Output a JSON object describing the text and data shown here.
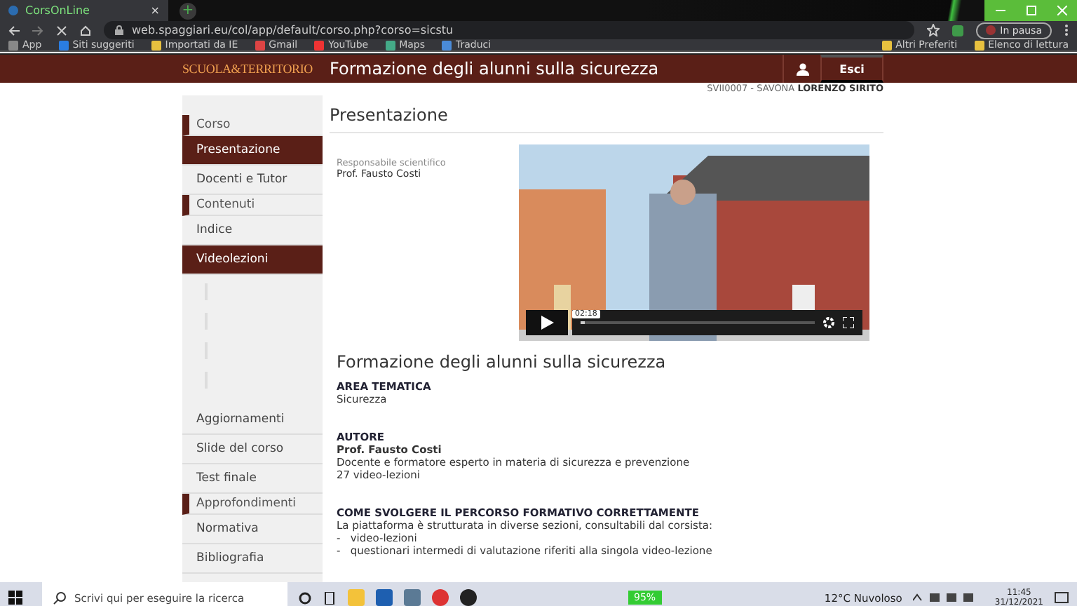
{
  "browser": {
    "tab": {
      "title": "CorsOnLine",
      "close": "×",
      "new_tab": "+"
    },
    "url": "web.spaggiari.eu/col/app/default/corso.php?corso=sicstu",
    "profile": "In pausa",
    "bookmarks": [
      {
        "label": "App"
      },
      {
        "label": "Siti suggeriti"
      },
      {
        "label": "Importati da IE"
      },
      {
        "label": "Gmail"
      },
      {
        "label": "YouTube"
      },
      {
        "label": "Maps"
      },
      {
        "label": "Traduci"
      }
    ],
    "bookmarks_right": [
      {
        "label": "Altri Preferiti"
      },
      {
        "label": "Elenco di lettura"
      }
    ]
  },
  "header": {
    "logo": "SCUOLA&TERRITORIO",
    "title": "Formazione degli alunni sulla sicurezza",
    "logout": "Esci",
    "user_line": "SVII0007 - SAVONA **LORENZO SIRITO**"
  },
  "sidebar": {
    "items": [
      {
        "kind": "section",
        "label": "Corso",
        "selected": false
      },
      {
        "kind": "link",
        "label": "Presentazione",
        "selected": true
      },
      {
        "kind": "link",
        "label": "Docenti e Tutor",
        "selected": false
      },
      {
        "kind": "section",
        "label": "Contenuti",
        "selected": false
      },
      {
        "kind": "link",
        "label": "Indice",
        "selected": false
      },
      {
        "kind": "link",
        "label": "Videolezioni",
        "selected": true
      },
      {
        "kind": "loading"
      },
      {
        "kind": "link",
        "label": "Aggiornamenti",
        "selected": false
      },
      {
        "kind": "link",
        "label": "Slide del corso",
        "selected": false
      },
      {
        "kind": "link",
        "label": "Test finale",
        "selected": false
      },
      {
        "kind": "section",
        "label": "Approfondimenti",
        "selected": false
      },
      {
        "kind": "link",
        "label": "Normativa",
        "selected": false
      },
      {
        "kind": "link",
        "label": "Bibliografia",
        "selected": false
      }
    ]
  },
  "main": {
    "heading": "Presentazione",
    "responsible_label": "Responsabile scientifico",
    "responsible_name": "Prof. Fausto Costi",
    "video": {
      "time": "02:18",
      "level": 0.02
    },
    "title": "Formazione degli alunni sulla sicurezza",
    "sections": [
      {
        "heading": "AREA TEMATICA",
        "lines": [
          {
            "text": "Sicurezza",
            "bold": false
          }
        ]
      },
      {
        "heading": "AUTORE",
        "lines": [
          {
            "text": "Prof. Fausto Costi",
            "bold": true
          },
          {
            "text": "Docente e formatore esperto in materia di sicurezza e prevenzione",
            "bold": false
          },
          {
            "text": "27 video-lezioni",
            "bold": false
          }
        ]
      },
      {
        "heading": "COME SVOLGERE IL PERCORSO FORMATIVO CORRETTAMENTE",
        "lines": [
          {
            "text": "La piattaforma è strutturata in diverse sezioni, consultabili dal corsista:",
            "bold": false
          },
          {
            "text": "-   video-lezioni",
            "bold": false
          },
          {
            "text": "-   questionari intermedi di valutazione riferiti alla singola video-lezione",
            "bold": false
          }
        ]
      }
    ]
  },
  "taskbar": {
    "search_placeholder": "Scrivi qui per eseguire la ricerca",
    "battery": "95%",
    "weather": "12°C  Nuvoloso",
    "time": "11:45",
    "date": "31/12/2021"
  }
}
